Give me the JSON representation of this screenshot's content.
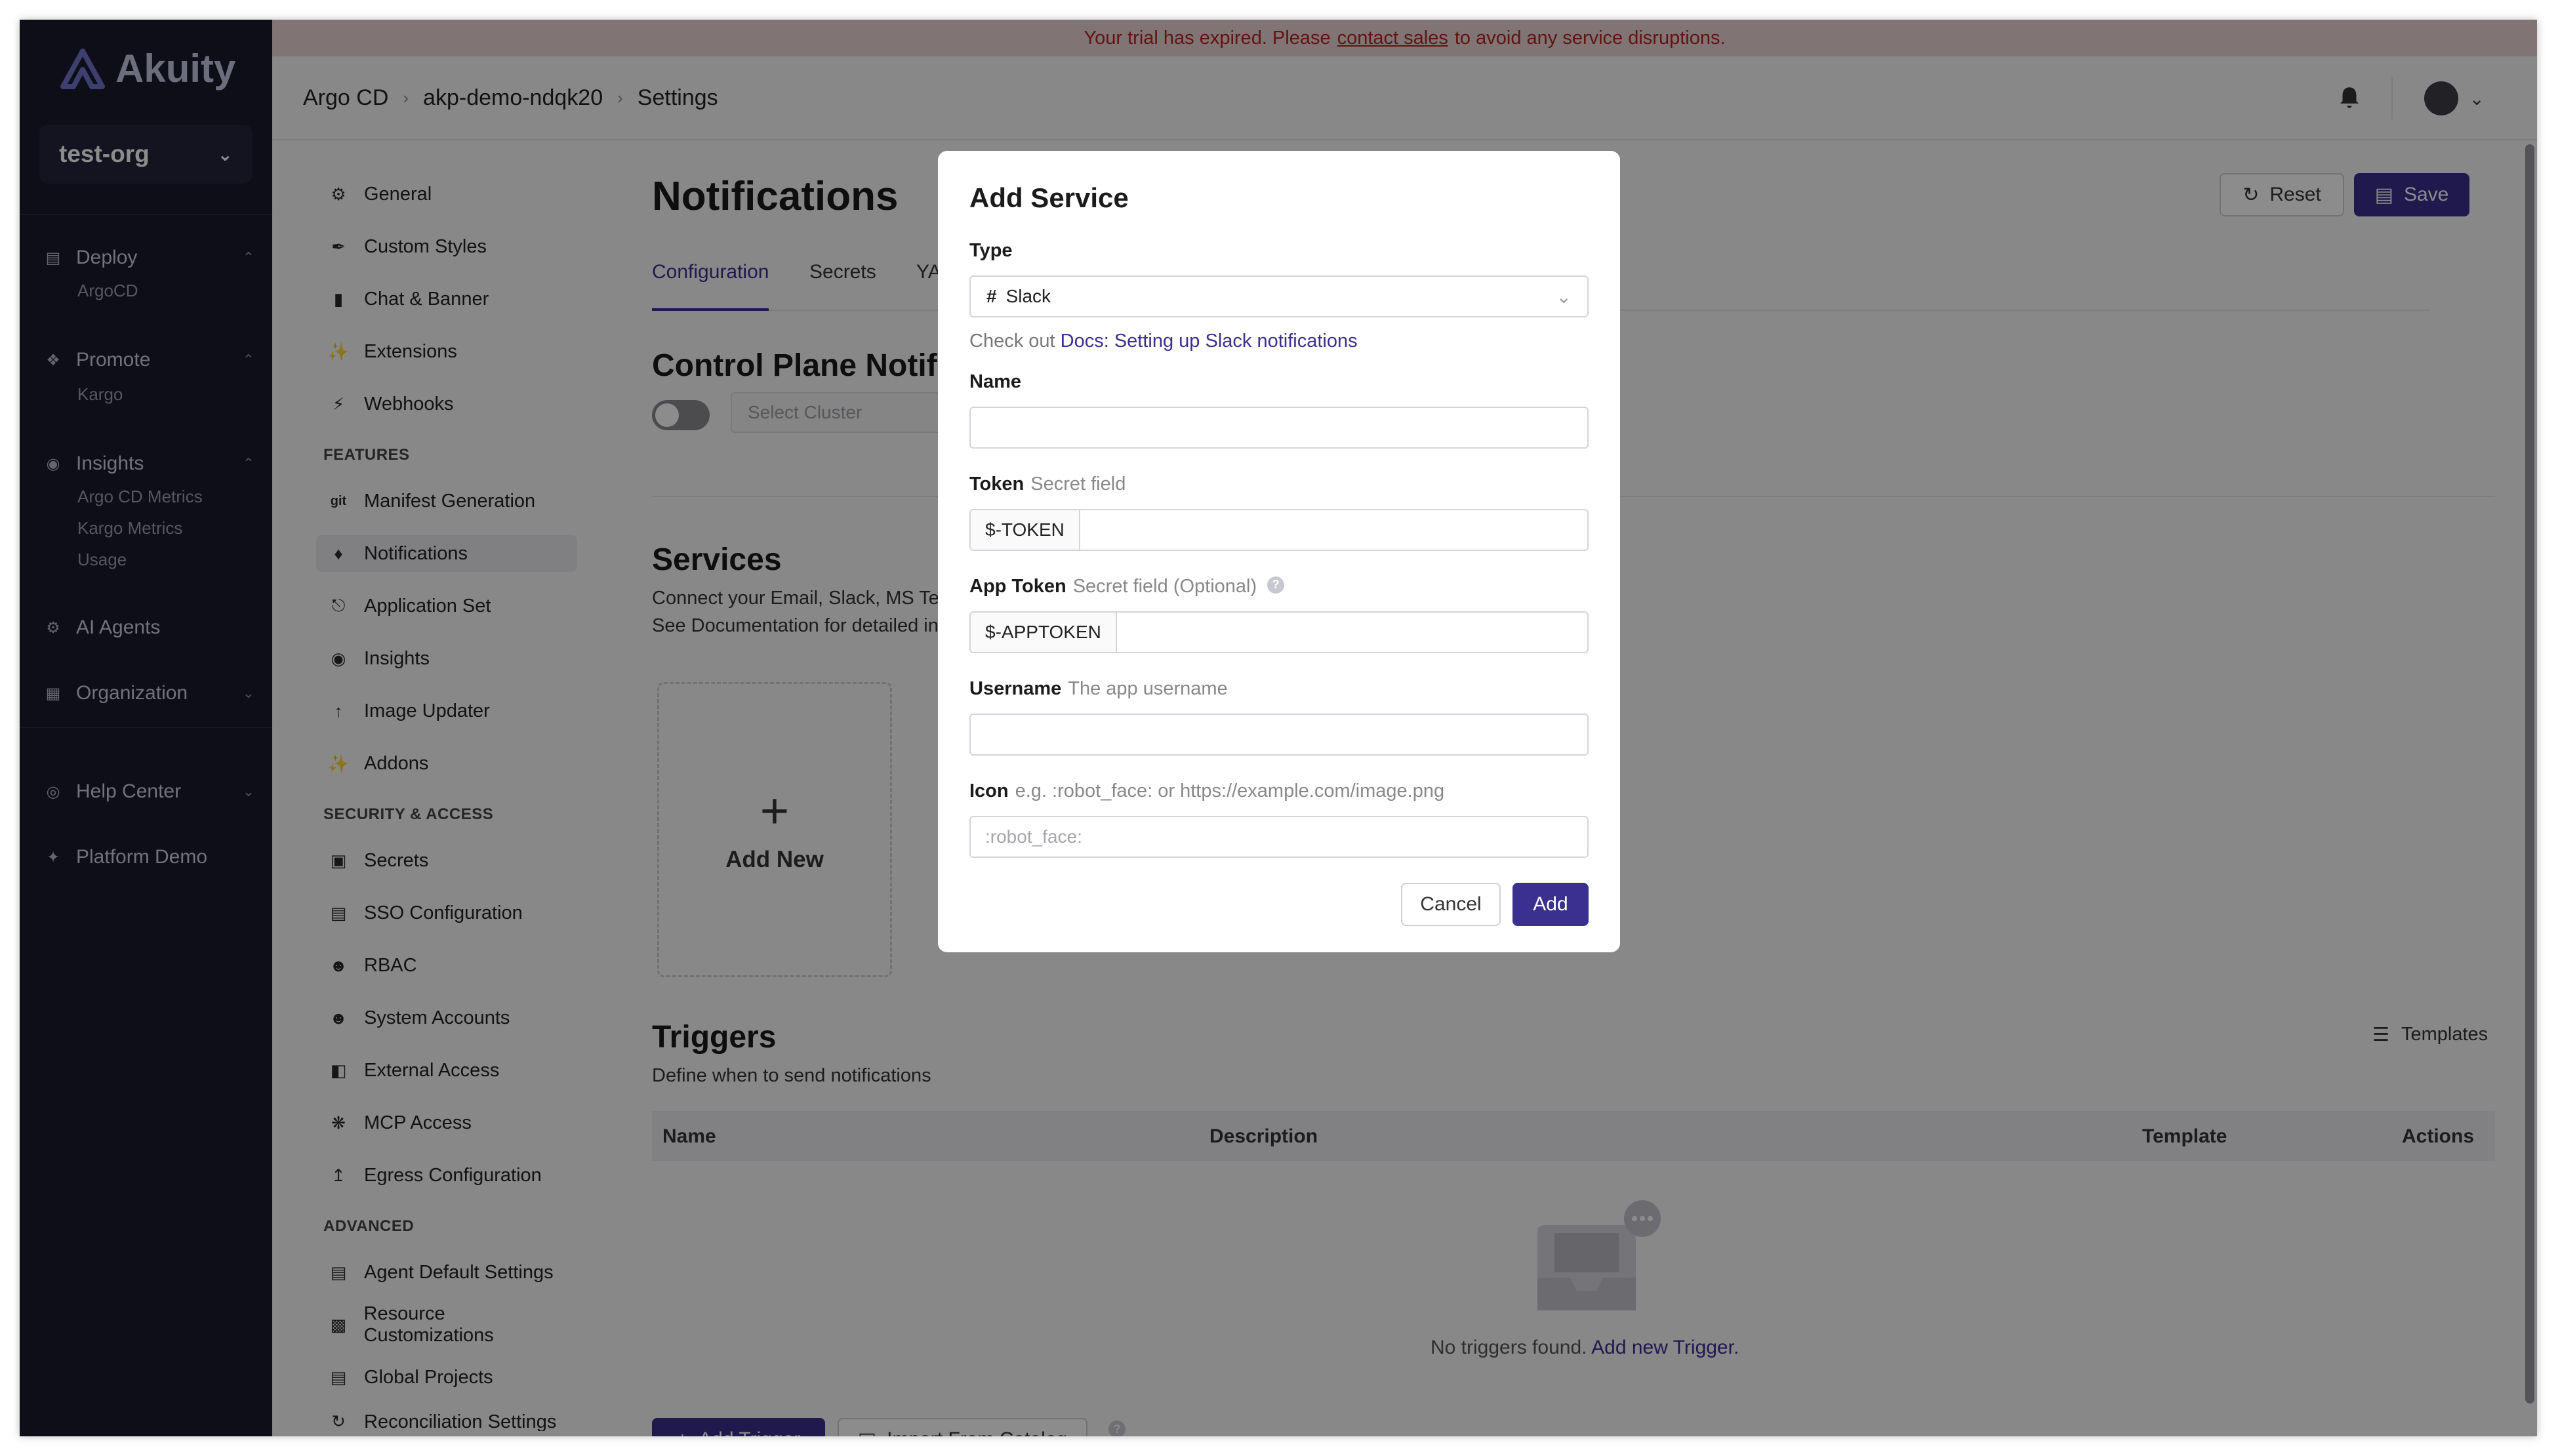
{
  "app": {
    "brand": "Akuity",
    "org": "test-org"
  },
  "nav": {
    "deploy": "Deploy",
    "deploy_sub": [
      "ArgoCD"
    ],
    "promote": "Promote",
    "promote_sub": [
      "Kargo"
    ],
    "insights": "Insights",
    "insights_sub": [
      "Argo CD Metrics",
      "Kargo Metrics",
      "Usage"
    ],
    "ai_agents": "AI Agents",
    "organization": "Organization",
    "help_center": "Help Center",
    "platform_demo": "Platform Demo"
  },
  "banner": {
    "before": "Your trial has expired. Please",
    "link": "contact sales",
    "after": "to avoid any service disruptions."
  },
  "breadcrumb": [
    "Argo CD",
    "akp-demo-ndqk20",
    "Settings"
  ],
  "settings_nav": {
    "general_items": [
      "General",
      "Custom Styles",
      "Chat & Banner",
      "Extensions",
      "Webhooks"
    ],
    "features_heading": "FEATURES",
    "features_items": [
      "Manifest Generation",
      "Notifications",
      "Application Set",
      "Insights",
      "Image Updater",
      "Addons"
    ],
    "security_heading": "SECURITY & ACCESS",
    "security_items": [
      "Secrets",
      "SSO Configuration",
      "RBAC",
      "System Accounts",
      "External Access",
      "MCP Access",
      "Egress Configuration"
    ],
    "advanced_heading": "ADVANCED",
    "advanced_items": [
      "Agent Default Settings",
      "Resource Customizations",
      "Global Projects",
      "Reconciliation Settings"
    ]
  },
  "page": {
    "title": "Notifications",
    "reset_label": "Reset",
    "save_label": "Save",
    "tabs": [
      "Configuration",
      "Secrets",
      "YAML"
    ],
    "control_plane_title": "Control Plane Notifica",
    "select_cluster_placeholder": "Select Cluster",
    "services_title": "Services",
    "services_desc_1": "Connect your Email, Slack, MS Team",
    "services_desc_2": "See Documentation for detailed inst",
    "add_new_label": "Add New",
    "triggers_title": "Triggers",
    "triggers_desc": "Define when to send notifications",
    "templates_label": "Templates",
    "table_columns": [
      "Name",
      "Description",
      "Template",
      "Actions"
    ],
    "empty_text": "No triggers found.",
    "empty_link": "Add new Trigger.",
    "add_trigger_label": "Add Trigger",
    "import_label": "Import From Catalog"
  },
  "modal": {
    "title": "Add Service",
    "type_label": "Type",
    "type_value": "Slack",
    "docs_prefix": "Check out",
    "docs_link": "Docs: Setting up Slack notifications",
    "name_label": "Name",
    "token_label": "Token",
    "token_hint": "Secret field",
    "token_prefix": "$-TOKEN",
    "app_token_label": "App Token",
    "app_token_hint": "Secret field (Optional)",
    "app_token_prefix": "$-APPTOKEN",
    "username_label": "Username",
    "username_hint": "The app username",
    "icon_label": "Icon",
    "icon_hint": "e.g. :robot_face: or https://example.com/image.png",
    "icon_placeholder": ":robot_face:",
    "cancel_label": "Cancel",
    "add_label": "Add"
  },
  "colors": {
    "accent": "#3b2f8f",
    "sidebar": "#1a1a2e",
    "banner_bg": "#e9d4d4",
    "banner_text": "#b3261e"
  }
}
